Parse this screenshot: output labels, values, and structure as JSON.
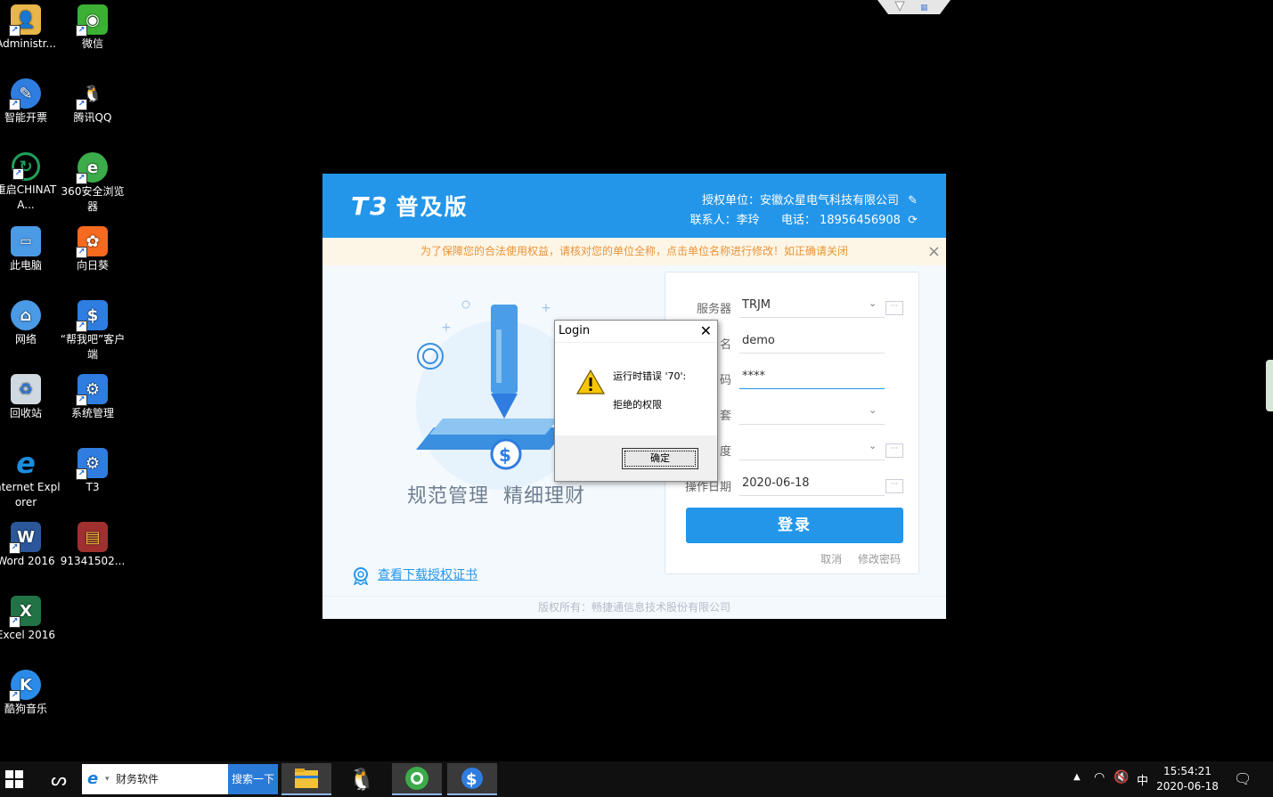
{
  "desktop": {
    "icons": [
      {
        "label": "Administr...",
        "icon": "user-folder-icon",
        "color": "#e8b64a"
      },
      {
        "label": "微信",
        "icon": "wechat-icon",
        "color": "#3cb034"
      },
      {
        "label": "智能开票",
        "icon": "invoice-app-icon",
        "color": "#2f7de0"
      },
      {
        "label": "腾讯QQ",
        "icon": "qq-icon",
        "color": "#ffffff"
      },
      {
        "label": "重启CHINATA...",
        "icon": "restart-icon",
        "color": "#1fa05a"
      },
      {
        "label": "360安全浏览器",
        "icon": "360-browser-icon",
        "color": "#3cab4a"
      },
      {
        "label": "此电脑",
        "icon": "computer-icon",
        "color": "#4a9ae6"
      },
      {
        "label": "向日葵",
        "icon": "sunflower-icon",
        "color": "#f56a1f"
      },
      {
        "label": "网络",
        "icon": "network-icon",
        "color": "#4a9ae6"
      },
      {
        "label": "“帮我吧”客户端",
        "icon": "helper-client-icon",
        "color": "#2f7de0"
      },
      {
        "label": "回收站",
        "icon": "recycle-bin-icon",
        "color": "#d0d8e0"
      },
      {
        "label": "系统管理",
        "icon": "system-admin-icon",
        "color": "#2f7de0"
      },
      {
        "label": "Internet Explorer",
        "icon": "internet-explorer-icon",
        "color": "#1a8fe0"
      },
      {
        "label": "T3",
        "icon": "t3-icon",
        "color": "#2f7de0"
      },
      {
        "label": "Word 2016",
        "icon": "word-icon",
        "color": "#2b579a"
      },
      {
        "label": "91341502...",
        "icon": "archive-icon",
        "color": "#a03030"
      },
      {
        "label": "Excel 2016",
        "icon": "excel-icon",
        "color": "#217346"
      },
      {
        "label": "酷狗音乐",
        "icon": "kugou-icon",
        "color": "#2a8ce8"
      }
    ]
  },
  "t3": {
    "logo": "T3",
    "edition": "普及版",
    "org_line": "授权单位：安徽众星电气科技有限公司",
    "contact": "联系人：李玲",
    "phone": "电话： 18956456908",
    "notice": "为了保障您的合法使用权益，请核对您的单位全称，点击单位名称进行修改！如正确请关闭",
    "slogan1": "规范管理",
    "slogan2": "精细理财",
    "form": {
      "server_label": "服务器",
      "server_value": "TRJM",
      "user_label": "名",
      "user_value": "demo",
      "password_label": "码",
      "password_value": "****",
      "account_label": "套",
      "account_value": "",
      "year_label": "度",
      "year_value": "",
      "date_label": "操作日期",
      "date_value": "2020-06-18"
    },
    "login_button": "登录",
    "cancel_link": "取消",
    "change_password_link": "修改密码",
    "cert_link": "查看下载授权证书",
    "footer": "版权所有：畅捷通信息技术股份有限公司",
    "accent_color": "#2396ea"
  },
  "dialog": {
    "title": "Login",
    "message1": "运行时错误 '70':",
    "message2": "拒绝的权限",
    "ok_button": "确定"
  },
  "taskbar": {
    "search_text": "财务软件",
    "search_button": "搜索一下",
    "ime": "中",
    "time": "15:54:21",
    "date": "2020-06-18"
  }
}
